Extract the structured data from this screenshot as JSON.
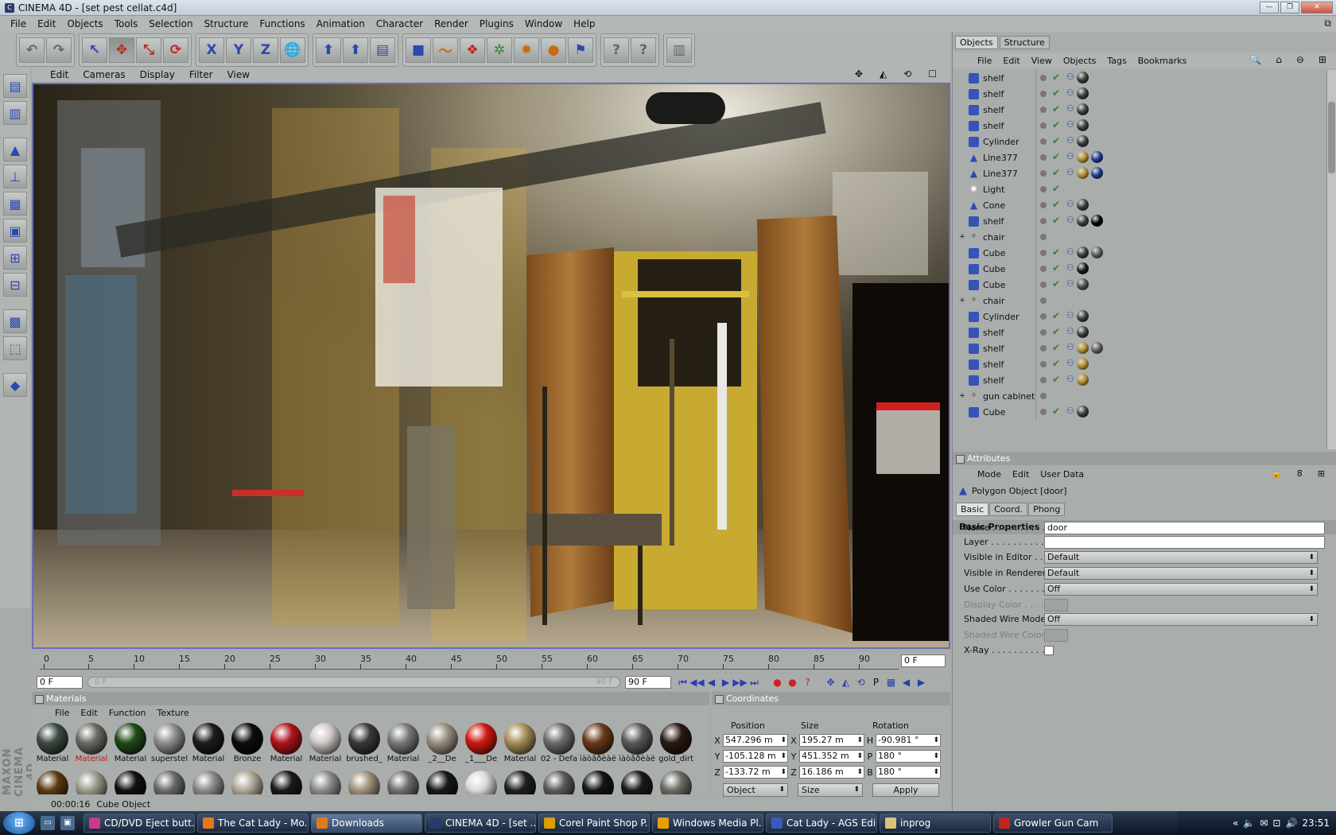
{
  "window": {
    "title": "CINEMA 4D - [set pest cellat.c4d]",
    "min": "—",
    "max": "❐",
    "close": "✕"
  },
  "menu": [
    "File",
    "Edit",
    "Objects",
    "Tools",
    "Selection",
    "Structure",
    "Functions",
    "Animation",
    "Character",
    "Render",
    "Plugins",
    "Window",
    "Help"
  ],
  "menu_right_icon": "⧉",
  "toolbar": {
    "undo": "↶",
    "redo": "↷",
    "select": "↖",
    "move": "✥",
    "scale": "⤡",
    "rotate": "⟳",
    "x": "X",
    "y": "Y",
    "z": "Z",
    "world": "🌐",
    "tool1": "⬆",
    "tool2": "⬆",
    "tool3": "▤",
    "cube": "■",
    "spline": "〜",
    "nurbs": "❖",
    "deform": "✲",
    "scene": "✹",
    "light": "●",
    "misc": "⚑",
    "help1": "?",
    "help2": "?",
    "layout": "▥"
  },
  "lefttools": [
    "▤",
    "▥",
    "▲",
    "⊥",
    "▦",
    "▣",
    "⊞",
    "⊟",
    "▩",
    "⬚",
    "◆"
  ],
  "maxon": "MAXON CINEMA 4D",
  "viewport_menu": [
    "Edit",
    "Cameras",
    "Display",
    "Filter",
    "View"
  ],
  "viewport_nav": [
    "✥",
    "◭",
    "⟲",
    "☐"
  ],
  "timeline": {
    "ticks": [
      "0",
      "5",
      "10",
      "15",
      "20",
      "25",
      "30",
      "35",
      "40",
      "45",
      "50",
      "55",
      "60",
      "65",
      "70",
      "75",
      "80",
      "85",
      "90"
    ],
    "current": "0 F"
  },
  "playbar": {
    "start": "0 F",
    "slider_left": "0 F",
    "slider_right": "90 F",
    "end": "90 F",
    "buttons": [
      "⏮",
      "◀◀",
      "◀",
      "▶",
      "▶▶",
      "⏭"
    ],
    "rec": [
      "●",
      "●",
      "?"
    ],
    "keys": [
      "✥",
      "◭",
      "⟲",
      "P",
      "▦",
      "◀",
      "▶"
    ]
  },
  "materials": {
    "title": "Materials",
    "menu": [
      "File",
      "Edit",
      "Function",
      "Texture"
    ],
    "items": [
      {
        "name": "Material",
        "color": "#3d4a42"
      },
      {
        "name": "Material",
        "color": "#6c6a62",
        "highlight": true
      },
      {
        "name": "Material",
        "color": "#1f4a1a"
      },
      {
        "name": "superstel",
        "color": "#8e8e8e"
      },
      {
        "name": "Material",
        "color": "#1c1c1c"
      },
      {
        "name": "Bronze",
        "color": "#0d0d0d"
      },
      {
        "name": "Material",
        "color": "#b0141a"
      },
      {
        "name": "Material",
        "color": "#cfc8c6"
      },
      {
        "name": "brushed_",
        "color": "#3a3a3a"
      },
      {
        "name": "Material",
        "color": "#7a7a7a"
      },
      {
        "name": "_2__De",
        "color": "#9a9080"
      },
      {
        "name": "_1___De",
        "color": "#cf1a12"
      },
      {
        "name": "Material",
        "color": "#a88e5a"
      },
      {
        "name": "02 - Defa",
        "color": "#6c6c6c"
      },
      {
        "name": "ìàòåðèàë",
        "color": "#6b3a1c"
      },
      {
        "name": "ìàòåðèàë",
        "color": "#5a5a5a"
      },
      {
        "name": "gold_dirt",
        "color": "#2a1a12"
      }
    ],
    "row2": [
      "#5a3a12",
      "#9a9a8c",
      "#101010",
      "#6a6a6a",
      "#8a8a8a",
      "#b0a898",
      "#1a1a1a",
      "#8a8a8a",
      "#a09078",
      "#6c6c6c",
      "#181818",
      "#d8d8d8",
      "#202020",
      "#5a5a5a",
      "#141414",
      "#1a1a1a",
      "#6a6a62"
    ]
  },
  "coordinates": {
    "title": "Coordinates",
    "headers": [
      "Position",
      "Size",
      "Rotation"
    ],
    "rows": [
      {
        "a": "X",
        "pos": "547.296 m",
        "b": "X",
        "size": "195.27 m",
        "c": "H",
        "rot": "-90.981 °"
      },
      {
        "a": "Y",
        "pos": "-105.128 m",
        "b": "Y",
        "size": "451.352 m",
        "c": "P",
        "rot": "180 °"
      },
      {
        "a": "Z",
        "pos": "-133.72 m",
        "b": "Z",
        "size": "16.186 m",
        "c": "B",
        "rot": "180 °"
      }
    ],
    "mode": "Object",
    "sizemode": "Size",
    "apply": "Apply"
  },
  "status": {
    "time": "00:00:16",
    "text": "Cube Object"
  },
  "objects": {
    "tabs": [
      "Objects",
      "Structure"
    ],
    "menu": [
      "File",
      "Edit",
      "View",
      "Objects",
      "Tags",
      "Bookmarks"
    ],
    "menu_icons": [
      "🔍",
      "⌂",
      "⊖",
      "⊞"
    ],
    "rows": [
      {
        "name": "shelf",
        "icon": "cube",
        "tags": [
          "#3a3a3a"
        ]
      },
      {
        "name": "shelf",
        "icon": "cube",
        "tags": [
          "#3a3a3a"
        ]
      },
      {
        "name": "shelf",
        "icon": "cube",
        "tags": [
          "#3a3a3a"
        ]
      },
      {
        "name": "shelf",
        "icon": "cube",
        "tags": [
          "#3a3a3a"
        ]
      },
      {
        "name": "Cylinder",
        "icon": "cube",
        "tags": [
          "#3a3a3a"
        ]
      },
      {
        "name": "Line377",
        "icon": "line",
        "tags": [
          "#b08a30",
          "#1a3a8a"
        ]
      },
      {
        "name": "Line377",
        "icon": "line",
        "tags": [
          "#b08a30",
          "#1a3a8a"
        ]
      },
      {
        "name": "Light",
        "icon": "light",
        "tags": []
      },
      {
        "name": "Cone",
        "icon": "cone",
        "tags": [
          "#3a3a3a"
        ]
      },
      {
        "name": "shelf",
        "icon": "cube",
        "tags": [
          "#3a3a3a",
          "#000000"
        ]
      },
      {
        "name": "chair",
        "icon": "null",
        "expand": "+",
        "tags": []
      },
      {
        "name": "Cube",
        "icon": "cube",
        "tags": [
          "#3a3a3a",
          "#5a5a5a"
        ]
      },
      {
        "name": "Cube",
        "icon": "cube",
        "tags": [
          "#1a1a1a"
        ]
      },
      {
        "name": "Cube",
        "icon": "cube",
        "tags": [
          "#4a4a4a"
        ]
      },
      {
        "name": "chair",
        "icon": "null",
        "expand": "+",
        "tags": []
      },
      {
        "name": "Cylinder",
        "icon": "cube",
        "tags": [
          "#3a3a3a"
        ]
      },
      {
        "name": "shelf",
        "icon": "cube",
        "tags": [
          "#3a3a3a"
        ]
      },
      {
        "name": "shelf",
        "icon": "cube",
        "tags": [
          "#b08a30",
          "#5a5a5a"
        ]
      },
      {
        "name": "shelf",
        "icon": "cube",
        "tags": [
          "#b08a30"
        ]
      },
      {
        "name": "shelf",
        "icon": "cube",
        "tags": [
          "#b08a30"
        ]
      },
      {
        "name": "gun cabinet",
        "icon": "null",
        "expand": "+",
        "tags": []
      },
      {
        "name": "Cube",
        "icon": "cube",
        "tags": [
          "#3a3a3a"
        ]
      }
    ]
  },
  "attributes": {
    "title": "Attributes",
    "menu": [
      "Mode",
      "Edit",
      "User Data"
    ],
    "menu_icons": [
      "🔒",
      "8",
      "⊞"
    ],
    "object": "Polygon Object [door]",
    "tabs": [
      "Basic",
      "Coord.",
      "Phong"
    ],
    "section": "Basic Properties",
    "fields": [
      {
        "label": "Name . . . . . . . . . . . .",
        "type": "text",
        "value": "door"
      },
      {
        "label": "Layer . . . . . . . . . . . .",
        "type": "text",
        "value": ""
      },
      {
        "label": "Visible in Editor . . . . .",
        "type": "drop",
        "value": "Default"
      },
      {
        "label": "Visible in Renderer . .",
        "type": "drop",
        "value": "Default"
      },
      {
        "label": "Use Color . . . . . . . . .",
        "type": "drop",
        "value": "Off"
      },
      {
        "label": "Display Color . . . . .",
        "type": "swatch",
        "value": "",
        "dim": true
      },
      {
        "label": "Shaded Wire Mode",
        "type": "drop",
        "value": "Off"
      },
      {
        "label": "Shaded Wire Color",
        "type": "swatch",
        "value": "",
        "dim": true
      },
      {
        "label": "X-Ray . . . . . . . . . . . .",
        "type": "check",
        "value": ""
      }
    ]
  },
  "taskbar": {
    "start": "⊞",
    "quick": [
      "▭",
      "▣"
    ],
    "tasks": [
      {
        "label": "CD/DVD Eject butt...",
        "color": "#c93b8a"
      },
      {
        "label": "The Cat Lady - Mo...",
        "color": "#e2791a"
      },
      {
        "label": "Downloads",
        "color": "#e2791a",
        "active": true
      },
      {
        "label": "CINEMA 4D - [set ...",
        "color": "#2a3b6b"
      },
      {
        "label": "Corel Paint Shop P...",
        "color": "#d9a000"
      },
      {
        "label": "Windows Media Pl...",
        "color": "#e8a000"
      },
      {
        "label": "Cat Lady - AGS Edi...",
        "color": "#3a5ab8"
      },
      {
        "label": "inprog",
        "color": "#d9c27a"
      },
      {
        "label": "Growler Gun Cam",
        "color": "#c0241c"
      }
    ],
    "tray": [
      "«",
      "🔈",
      "✉",
      "⊡",
      "🔊"
    ],
    "clock": "23:51"
  }
}
